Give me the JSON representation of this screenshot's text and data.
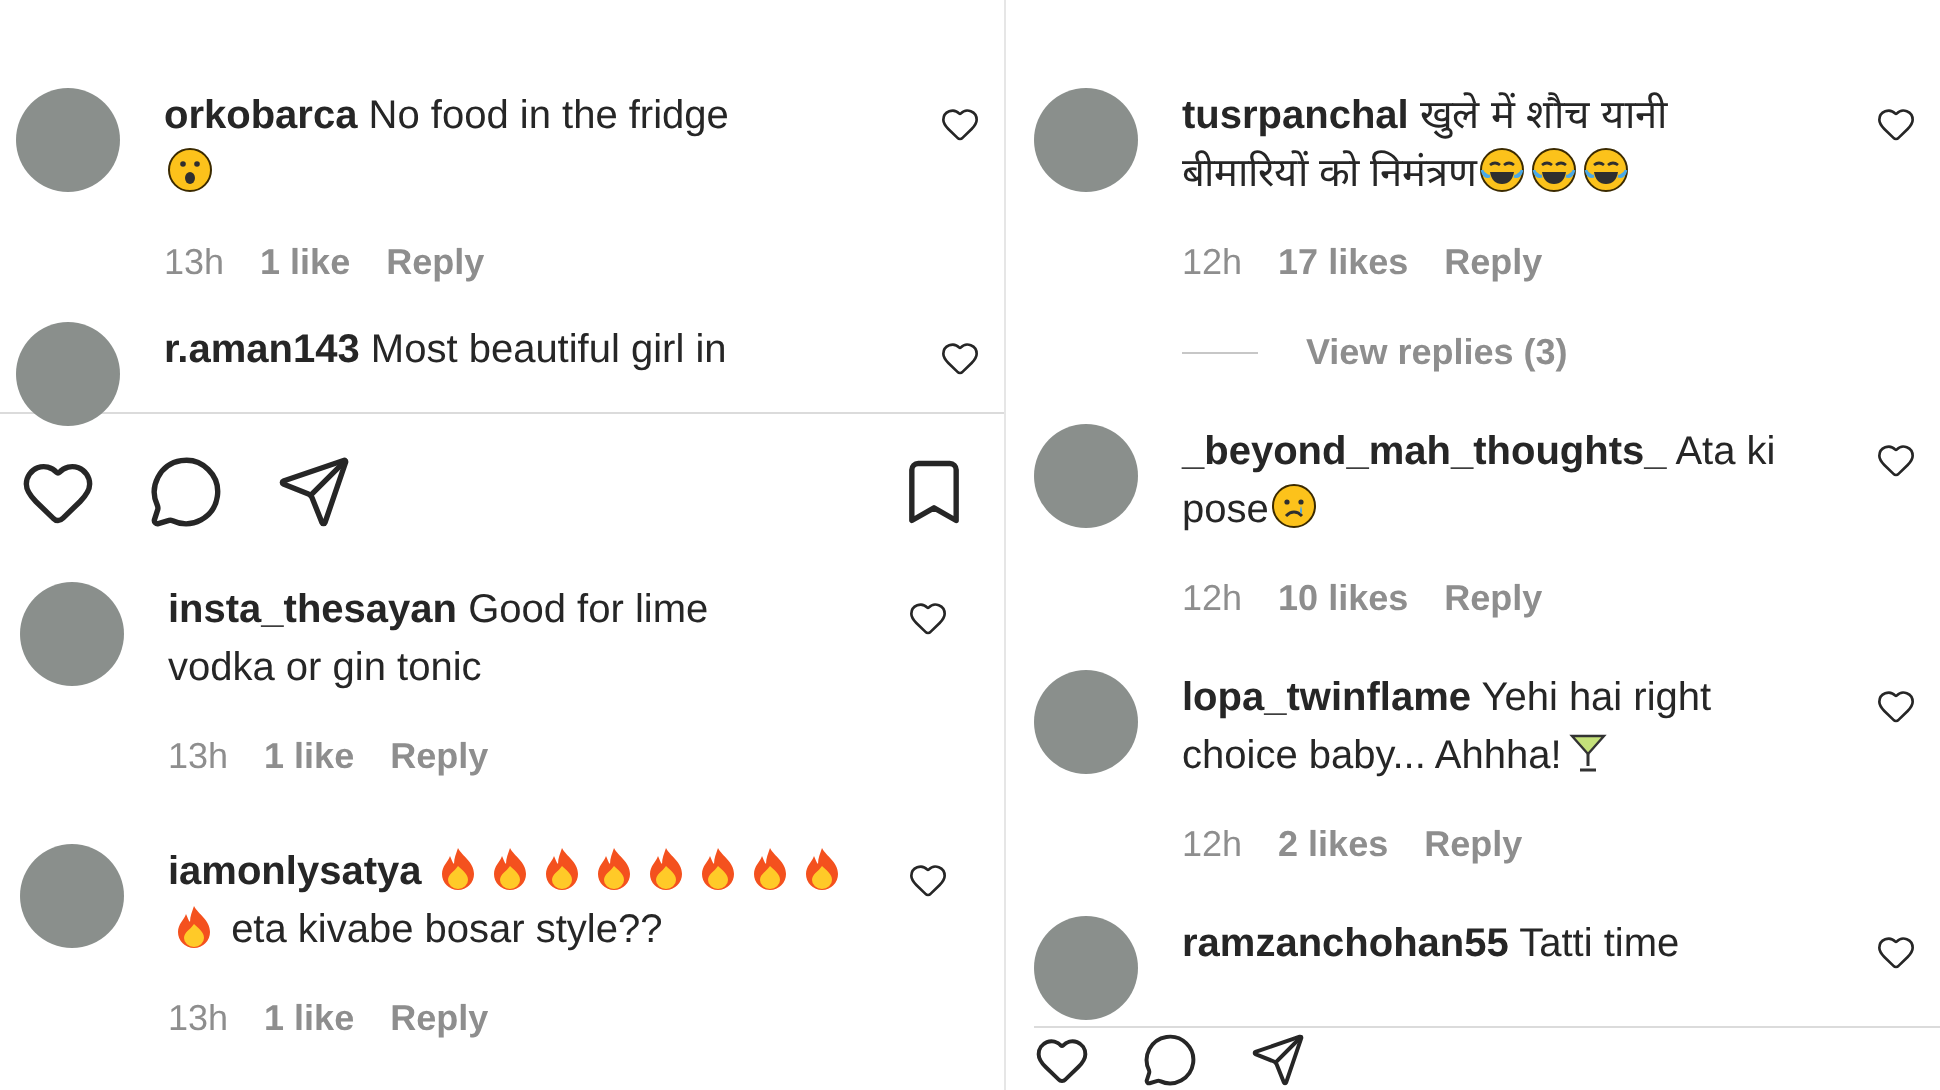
{
  "panels": [
    {
      "comments": [
        {
          "username": "orkobarca",
          "body": [
            {
              "kind": "text",
              "text": "No food in the fridge"
            },
            {
              "kind": "break"
            },
            {
              "kind": "surprised"
            }
          ],
          "time": "13h",
          "likes": "1 like",
          "reply": "Reply"
        },
        {
          "username": "r.aman143",
          "body": [
            {
              "kind": "text",
              "text": "Most beautiful girl in"
            }
          ]
        }
      ]
    },
    {
      "comments": [
        {
          "username": "insta_thesayan",
          "body": [
            {
              "kind": "text",
              "text": "Good for lime"
            },
            {
              "kind": "break"
            },
            {
              "kind": "text",
              "text": "vodka or gin tonic"
            }
          ],
          "time": "13h",
          "likes": "1 like",
          "reply": "Reply"
        },
        {
          "username": "iamonlysatya",
          "body": [
            {
              "kind": "fire"
            },
            {
              "kind": "fire"
            },
            {
              "kind": "fire"
            },
            {
              "kind": "fire"
            },
            {
              "kind": "fire"
            },
            {
              "kind": "fire"
            },
            {
              "kind": "fire"
            },
            {
              "kind": "fire"
            },
            {
              "kind": "break"
            },
            {
              "kind": "fire"
            },
            {
              "kind": "text",
              "text": "eta kivabe bosar style??"
            }
          ],
          "time": "13h",
          "likes": "1 like",
          "reply": "Reply"
        }
      ]
    },
    {
      "comments": [
        {
          "username": "tusrpanchal",
          "body": [
            {
              "kind": "text",
              "text": "खुले में शौच यानी"
            },
            {
              "kind": "break"
            },
            {
              "kind": "text",
              "text": "बीमारियों को निमंत्रण"
            },
            {
              "kind": "laughing"
            },
            {
              "kind": "laughing"
            },
            {
              "kind": "laughing"
            }
          ],
          "time": "12h",
          "likes": "17 likes",
          "reply": "Reply",
          "view_replies": "View replies (3)"
        },
        {
          "username": "_beyond_mah_thoughts_",
          "body": [
            {
              "kind": "text",
              "text": "Ata ki"
            },
            {
              "kind": "break"
            },
            {
              "kind": "text",
              "text": "pose"
            },
            {
              "kind": "crying"
            }
          ],
          "time": "12h",
          "likes": "10 likes",
          "reply": "Reply"
        },
        {
          "username": "lopa_twinflame",
          "body": [
            {
              "kind": "text",
              "text": "Yehi hai right"
            },
            {
              "kind": "break"
            },
            {
              "kind": "text",
              "text": "choice baby... Ahhha!"
            },
            {
              "kind": "cocktail"
            }
          ],
          "time": "12h",
          "likes": "2 likes",
          "reply": "Reply"
        },
        {
          "username": "ramzanchohan55",
          "body": [
            {
              "kind": "text",
              "text": "Tatti time"
            }
          ]
        }
      ]
    }
  ]
}
